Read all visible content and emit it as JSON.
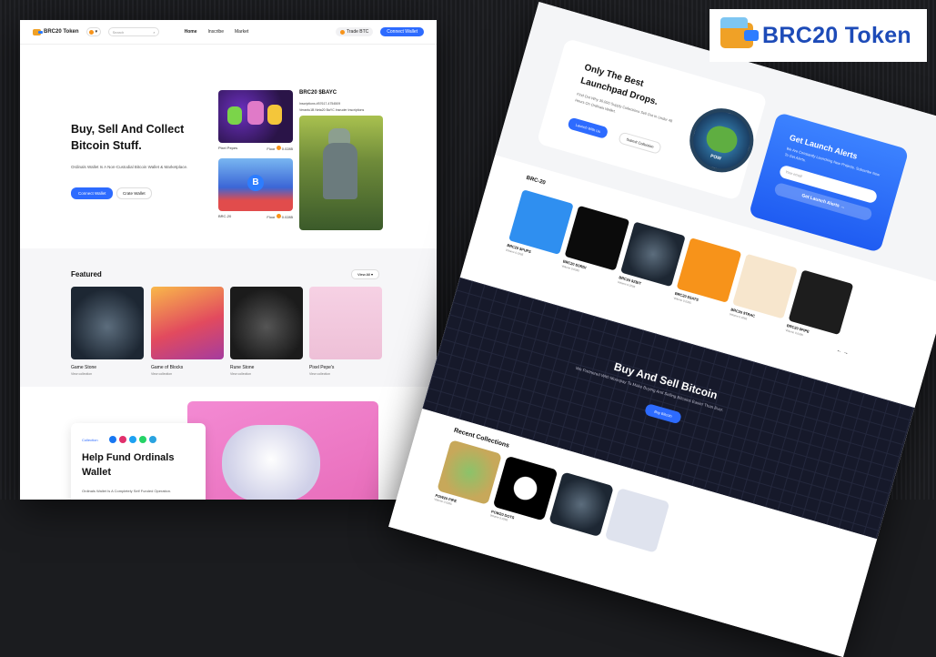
{
  "brand": {
    "title": "BRC20 Token"
  },
  "left_page": {
    "nav": {
      "logo": "BRC20 Token",
      "search_placeholder": "Search",
      "links": [
        "Home",
        "Inscribe",
        "Market"
      ],
      "trade_btn": "Trade BTC",
      "connect_btn": "Connect Wallet"
    },
    "hero": {
      "title": "Buy, Sell And Collect Bitcoin Stuff.",
      "subtitle": "Ordinals Wallet Is A Non-Custodial Bitcoin Wallet & Marketplace.",
      "primary_btn": "Connect Wallet",
      "secondary_btn": "Crate Wallet",
      "big_nft_title": "BRC20 $BAYC",
      "big_nft_sub1": "Inscriptions #57617-4754509",
      "big_nft_sub2": "Verantu1B Neta20 BaYC Insruder Inscriptions",
      "nfts": [
        {
          "name": "Pixel Pepes",
          "price": "0.0285"
        },
        {
          "name": "BRC-20",
          "price": "0.0285"
        }
      ],
      "floor_label": "Floor"
    },
    "featured": {
      "title": "Featured",
      "view_all": "View All",
      "cards": [
        {
          "title": "Game Stone",
          "sub": "View collection"
        },
        {
          "title": "Game of Blocks",
          "sub": "View collection"
        },
        {
          "title": "Rune Stone",
          "sub": "View collection"
        },
        {
          "title": "Pixel Pepe's",
          "sub": "View collection"
        }
      ]
    },
    "fund": {
      "tag": "Collection",
      "title": "Help Fund Ordinals Wallet",
      "text": "Ordinals Wallet Is A Completely Self Funded Operation."
    }
  },
  "right_page": {
    "launch": {
      "title": "Only The Best Launchpad Drops.",
      "text": "Find Out Why 30,000 Supply Collections Sell Out In Under 48 Hours On Ordinals Wallet.",
      "primary_btn": "Launch With Us",
      "secondary_btn": "Submit Collection",
      "coin_text": "POW"
    },
    "alerts": {
      "title": "Get Launch Alerts",
      "text": "We Are Constantly Launching New Projects. Subscribe Now To Get Alerts.",
      "email_placeholder": "Your email",
      "button": "Get Launch Alerts"
    },
    "brc": {
      "title": "BRC-20",
      "tiles": [
        {
          "name": "BRC20 $PUPS",
          "vol": "Volume 0.0285"
        },
        {
          "name": "BRC20 $ORDI",
          "vol": "Volume 0.0285"
        },
        {
          "name": "BRC20 $ZBIT",
          "vol": "Volume 0.0285"
        },
        {
          "name": "BRC20 $SATS",
          "vol": "Volume 0.0285"
        },
        {
          "name": "BRC20 $TRAC",
          "vol": "Volume 0.0285"
        },
        {
          "name": "BRC20 $PIPE",
          "vol": "Volume 0.0285"
        }
      ]
    },
    "dark": {
      "title": "Buy And Sell Bitcoin",
      "text": "We Partnered With Moonpay To Make Buying And Selling Bitcoins Easier Than Ever.",
      "button": "Buy Bitcoin"
    },
    "recent": {
      "title": "Recent Collections",
      "tiles": [
        {
          "name": "POW20 PIPE",
          "vol": "Volume 0.0285"
        },
        {
          "name": "POW20 DOTS",
          "vol": "Volume 0.0285"
        }
      ]
    }
  },
  "colors": {
    "accent": "#2d6bff",
    "brand_text": "#1d4bb8",
    "wallet_orange": "#f0a126"
  }
}
